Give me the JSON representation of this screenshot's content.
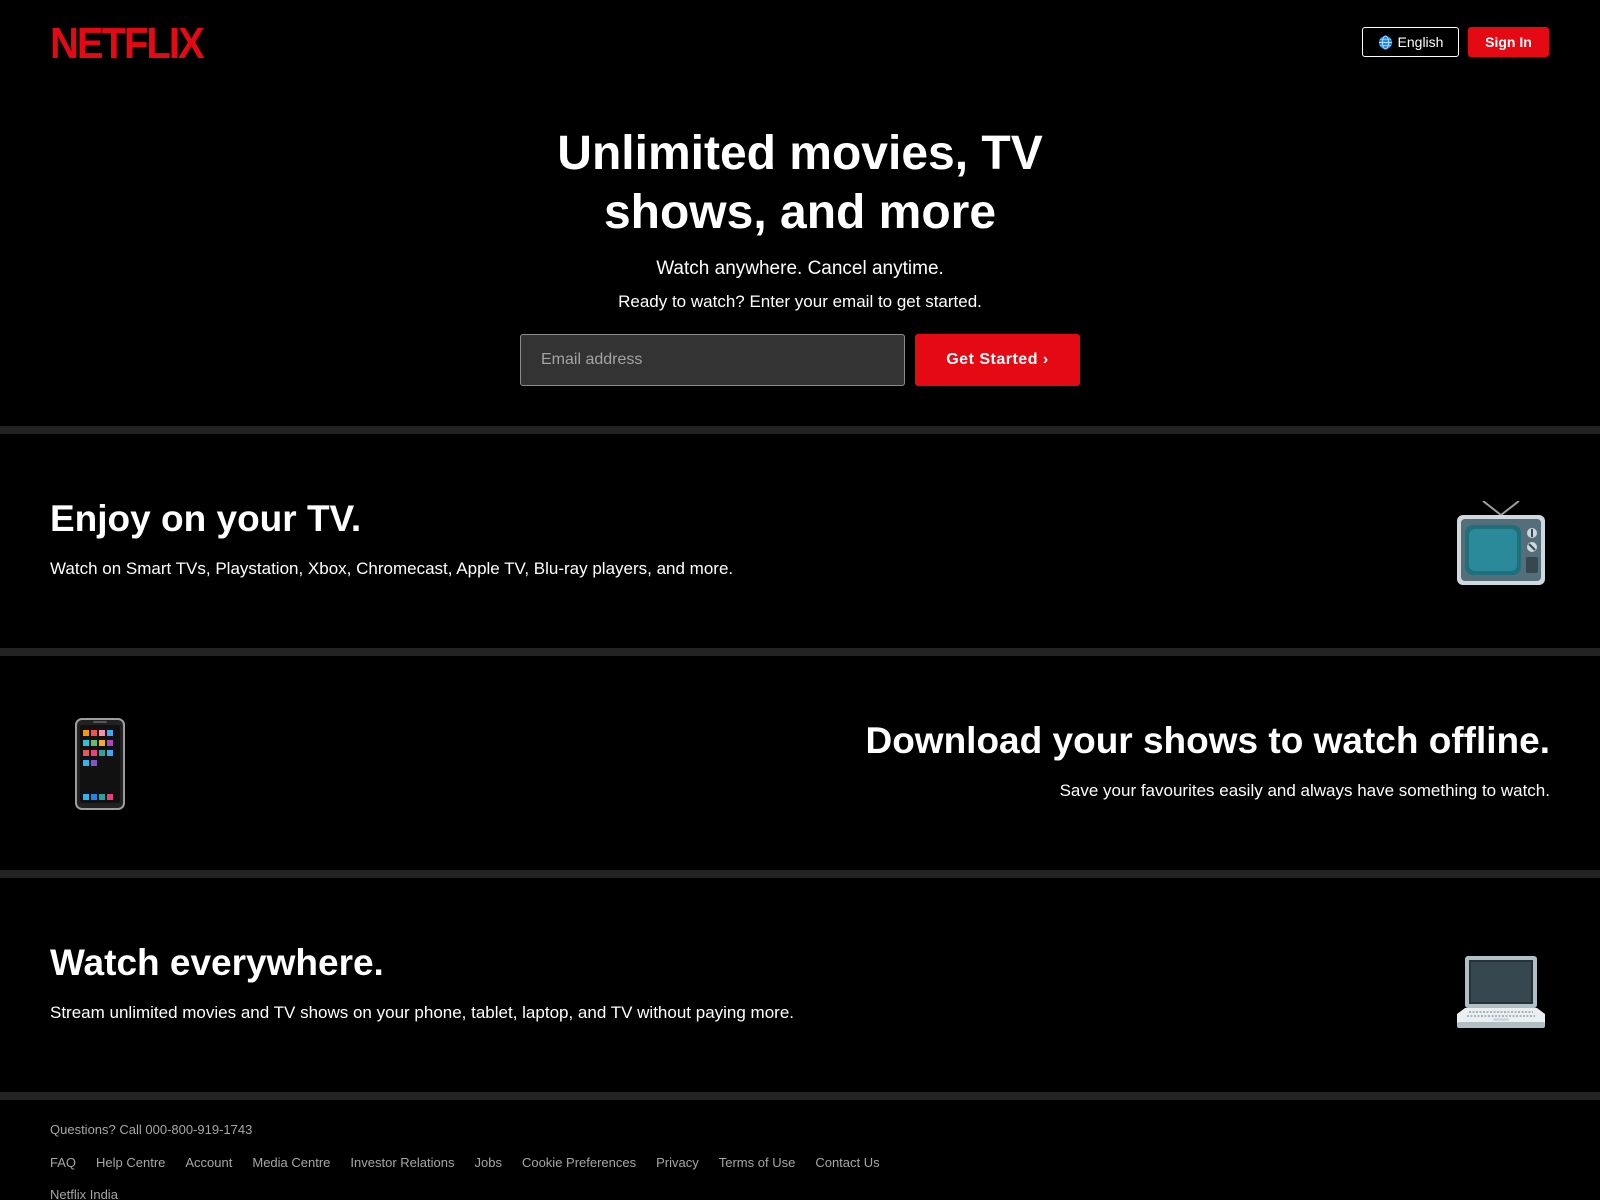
{
  "colors": {
    "brand_red": "#e50914",
    "background": "#000000",
    "divider": "#232323",
    "footer_text": "#a6a6a6"
  },
  "header": {
    "logo": "NETFLIX",
    "language_label": "English",
    "language_icon": "globe-icon",
    "signin_label": "Sign In"
  },
  "hero": {
    "title": "Unlimited movies, TV shows, and more",
    "subtitle": "Watch anywhere. Cancel anytime.",
    "ready_text": "Ready to watch? Enter your email to get started.",
    "email_placeholder": "Email address",
    "email_value": "",
    "cta_label": "Get Started ›"
  },
  "features": [
    {
      "title": "Enjoy on your TV.",
      "text": "Watch on Smart TVs, Playstation, Xbox, Chromecast, Apple TV, Blu-ray players, and more.",
      "icon": "tv-icon"
    },
    {
      "title": "Download your shows to watch offline.",
      "text": "Save your favourites easily and always have something to watch.",
      "icon": "mobile-phone-icon"
    },
    {
      "title": "Watch everywhere.",
      "text": "Stream unlimited movies and TV shows on your phone, tablet, laptop, and TV without paying more.",
      "icon": "laptop-icon"
    }
  ],
  "footer": {
    "questions": "Questions? Call 000-800-919-1743",
    "links": [
      "FAQ",
      "Help Centre",
      "Account",
      "Media Centre",
      "Investor Relations",
      "Jobs",
      "Cookie Preferences",
      "Privacy",
      "Terms of Use",
      "Contact Us"
    ],
    "country": "Netflix India"
  }
}
